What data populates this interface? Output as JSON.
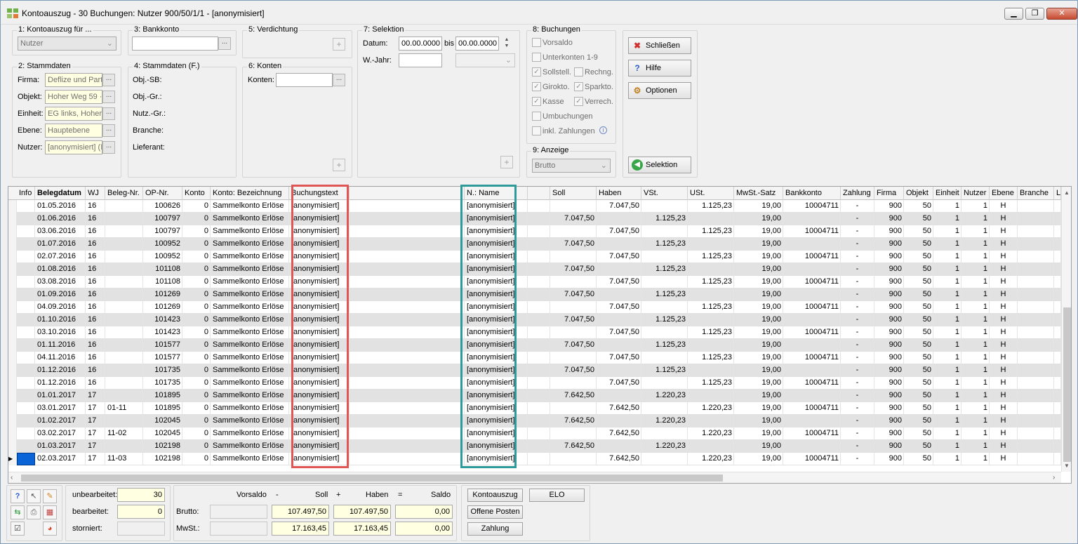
{
  "window": {
    "title": "Kontoauszug - 30 Buchungen:  Nutzer 900/50/1/1 - [anonymisiert]",
    "minimize": "▁",
    "restore": "❐",
    "close": "✕"
  },
  "g1": {
    "title": "1: Kontoauszug für ...",
    "value": "Nutzer"
  },
  "g2": {
    "title": "2: Stammdaten",
    "firma_label": "Firma:",
    "firma": "Deflize und Part",
    "objekt_label": "Objekt:",
    "objekt": "Hoher Weg 59 ·",
    "einheit_label": "Einheit:",
    "einheit": "EG links, Hoher",
    "ebene_label": "Ebene:",
    "ebene": "Hauptebene",
    "nutzer_label": "Nutzer:",
    "nutzer": "[anonymisiert]  (I"
  },
  "g3": {
    "title": "3: Bankkonto",
    "value": ""
  },
  "g4": {
    "title": "4: Stammdaten (F.)",
    "l1": "Obj.-SB:",
    "l2": "Obj.-Gr.:",
    "l3": "Nutz.-Gr.:",
    "l4": "Branche:",
    "l5": "Lieferant:"
  },
  "g5": {
    "title": "5: Verdichtung"
  },
  "g6": {
    "title": "6: Konten",
    "label": "Konten:",
    "value": ""
  },
  "g7": {
    "title": "7: Selektion",
    "datum_label": "Datum:",
    "from": "00.00.0000",
    "bis": "bis",
    "to": "00.00.0000",
    "wjahr_label": "W.-Jahr:",
    "wjahr": ""
  },
  "g8": {
    "title": "8: Buchungen",
    "vorsaldo": "Vorsaldo",
    "unterkonten": "Unterkonten 1-9",
    "sollstell": "Sollstell.",
    "rechng": "Rechng.",
    "girokto": "Girokto.",
    "sparkto": "Sparkto.",
    "kasse": "Kasse",
    "verrech": "Verrech.",
    "umbuchungen": "Umbuchungen",
    "inkl_zahlungen": "inkl. Zahlungen"
  },
  "g9": {
    "title": "9: Anzeige",
    "value": "Brutto"
  },
  "buttons": {
    "schliessen": "Schließen",
    "hilfe": "Hilfe",
    "optionen": "Optionen",
    "selektion": "Selektion"
  },
  "grid": {
    "headers": [
      "Info",
      "Belegdatum",
      "WJ",
      "Beleg-Nr.",
      "OP-Nr.",
      "Konto",
      "Konto: Bezeichnung",
      "Buchungstext",
      "",
      "N.: Name",
      "",
      "Soll",
      "Haben",
      "VSt.",
      "USt.",
      "MwSt.-Satz",
      "Bankkonto",
      "Zahlung",
      "Firma",
      "Objekt",
      "Einheit",
      "Nutzer",
      "Ebene",
      "Branche",
      "L"
    ],
    "rows": [
      [
        "",
        "01.05.2016",
        "16",
        "",
        "100626",
        "0",
        "Sammelkonto Erlöse",
        "[anonymisiert]",
        "",
        "[anonymisiert]",
        "",
        "",
        "7.047,50",
        "",
        "1.125,23",
        "19,00",
        "10004711",
        "-",
        "900",
        "50",
        "1",
        "1",
        "H",
        "",
        ""
      ],
      [
        "",
        "01.06.2016",
        "16",
        "",
        "100797",
        "0",
        "Sammelkonto Erlöse",
        "[anonymisiert]",
        "",
        "[anonymisiert]",
        "",
        "7.047,50",
        "",
        "1.125,23",
        "",
        "19,00",
        "",
        "-",
        "900",
        "50",
        "1",
        "1",
        "H",
        "",
        ""
      ],
      [
        "",
        "03.06.2016",
        "16",
        "",
        "100797",
        "0",
        "Sammelkonto Erlöse",
        "[anonymisiert]",
        "",
        "[anonymisiert]",
        "",
        "",
        "7.047,50",
        "",
        "1.125,23",
        "19,00",
        "10004711",
        "-",
        "900",
        "50",
        "1",
        "1",
        "H",
        "",
        ""
      ],
      [
        "",
        "01.07.2016",
        "16",
        "",
        "100952",
        "0",
        "Sammelkonto Erlöse",
        "[anonymisiert]",
        "",
        "[anonymisiert]",
        "",
        "7.047,50",
        "",
        "1.125,23",
        "",
        "19,00",
        "",
        "-",
        "900",
        "50",
        "1",
        "1",
        "H",
        "",
        ""
      ],
      [
        "",
        "02.07.2016",
        "16",
        "",
        "100952",
        "0",
        "Sammelkonto Erlöse",
        "[anonymisiert]",
        "",
        "[anonymisiert]",
        "",
        "",
        "7.047,50",
        "",
        "1.125,23",
        "19,00",
        "10004711",
        "-",
        "900",
        "50",
        "1",
        "1",
        "H",
        "",
        ""
      ],
      [
        "",
        "01.08.2016",
        "16",
        "",
        "101108",
        "0",
        "Sammelkonto Erlöse",
        "[anonymisiert]",
        "",
        "[anonymisiert]",
        "",
        "7.047,50",
        "",
        "1.125,23",
        "",
        "19,00",
        "",
        "-",
        "900",
        "50",
        "1",
        "1",
        "H",
        "",
        ""
      ],
      [
        "",
        "03.08.2016",
        "16",
        "",
        "101108",
        "0",
        "Sammelkonto Erlöse",
        "[anonymisiert]",
        "",
        "[anonymisiert]",
        "",
        "",
        "7.047,50",
        "",
        "1.125,23",
        "19,00",
        "10004711",
        "-",
        "900",
        "50",
        "1",
        "1",
        "H",
        "",
        ""
      ],
      [
        "",
        "01.09.2016",
        "16",
        "",
        "101269",
        "0",
        "Sammelkonto Erlöse",
        "[anonymisiert]",
        "",
        "[anonymisiert]",
        "",
        "7.047,50",
        "",
        "1.125,23",
        "",
        "19,00",
        "",
        "-",
        "900",
        "50",
        "1",
        "1",
        "H",
        "",
        ""
      ],
      [
        "",
        "04.09.2016",
        "16",
        "",
        "101269",
        "0",
        "Sammelkonto Erlöse",
        "[anonymisiert]",
        "",
        "[anonymisiert]",
        "",
        "",
        "7.047,50",
        "",
        "1.125,23",
        "19,00",
        "10004711",
        "-",
        "900",
        "50",
        "1",
        "1",
        "H",
        "",
        ""
      ],
      [
        "",
        "01.10.2016",
        "16",
        "",
        "101423",
        "0",
        "Sammelkonto Erlöse",
        "[anonymisiert]",
        "",
        "[anonymisiert]",
        "",
        "7.047,50",
        "",
        "1.125,23",
        "",
        "19,00",
        "",
        "-",
        "900",
        "50",
        "1",
        "1",
        "H",
        "",
        ""
      ],
      [
        "",
        "03.10.2016",
        "16",
        "",
        "101423",
        "0",
        "Sammelkonto Erlöse",
        "[anonymisiert]",
        "",
        "[anonymisiert]",
        "",
        "",
        "7.047,50",
        "",
        "1.125,23",
        "19,00",
        "10004711",
        "-",
        "900",
        "50",
        "1",
        "1",
        "H",
        "",
        ""
      ],
      [
        "",
        "01.11.2016",
        "16",
        "",
        "101577",
        "0",
        "Sammelkonto Erlöse",
        "[anonymisiert]",
        "",
        "[anonymisiert]",
        "",
        "7.047,50",
        "",
        "1.125,23",
        "",
        "19,00",
        "",
        "-",
        "900",
        "50",
        "1",
        "1",
        "H",
        "",
        ""
      ],
      [
        "",
        "04.11.2016",
        "16",
        "",
        "101577",
        "0",
        "Sammelkonto Erlöse",
        "[anonymisiert]",
        "",
        "[anonymisiert]",
        "",
        "",
        "7.047,50",
        "",
        "1.125,23",
        "19,00",
        "10004711",
        "-",
        "900",
        "50",
        "1",
        "1",
        "H",
        "",
        ""
      ],
      [
        "",
        "01.12.2016",
        "16",
        "",
        "101735",
        "0",
        "Sammelkonto Erlöse",
        "[anonymisiert]",
        "",
        "[anonymisiert]",
        "",
        "7.047,50",
        "",
        "1.125,23",
        "",
        "19,00",
        "",
        "-",
        "900",
        "50",
        "1",
        "1",
        "H",
        "",
        ""
      ],
      [
        "",
        "01.12.2016",
        "16",
        "",
        "101735",
        "0",
        "Sammelkonto Erlöse",
        "[anonymisiert]",
        "",
        "[anonymisiert]",
        "",
        "",
        "7.047,50",
        "",
        "1.125,23",
        "19,00",
        "10004711",
        "-",
        "900",
        "50",
        "1",
        "1",
        "H",
        "",
        ""
      ],
      [
        "",
        "01.01.2017",
        "17",
        "",
        "101895",
        "0",
        "Sammelkonto Erlöse",
        "[anonymisiert]",
        "",
        "[anonymisiert]",
        "",
        "7.642,50",
        "",
        "1.220,23",
        "",
        "19,00",
        "",
        "-",
        "900",
        "50",
        "1",
        "1",
        "H",
        "",
        ""
      ],
      [
        "",
        "03.01.2017",
        "17",
        "01-11",
        "101895",
        "0",
        "Sammelkonto Erlöse",
        "[anonymisiert]",
        "",
        "[anonymisiert]",
        "",
        "",
        "7.642,50",
        "",
        "1.220,23",
        "19,00",
        "10004711",
        "-",
        "900",
        "50",
        "1",
        "1",
        "H",
        "",
        ""
      ],
      [
        "",
        "01.02.2017",
        "17",
        "",
        "102045",
        "0",
        "Sammelkonto Erlöse",
        "[anonymisiert]",
        "",
        "[anonymisiert]",
        "",
        "7.642,50",
        "",
        "1.220,23",
        "",
        "19,00",
        "",
        "-",
        "900",
        "50",
        "1",
        "1",
        "H",
        "",
        ""
      ],
      [
        "",
        "03.02.2017",
        "17",
        "11-02",
        "102045",
        "0",
        "Sammelkonto Erlöse",
        "[anonymisiert]",
        "",
        "[anonymisiert]",
        "",
        "",
        "7.642,50",
        "",
        "1.220,23",
        "19,00",
        "10004711",
        "-",
        "900",
        "50",
        "1",
        "1",
        "H",
        "",
        ""
      ],
      [
        "",
        "01.03.2017",
        "17",
        "",
        "102198",
        "0",
        "Sammelkonto Erlöse",
        "[anonymisiert]",
        "",
        "[anonymisiert]",
        "",
        "7.642,50",
        "",
        "1.220,23",
        "",
        "19,00",
        "",
        "-",
        "900",
        "50",
        "1",
        "1",
        "H",
        "",
        ""
      ],
      [
        "",
        "02.03.2017",
        "17",
        "11-03",
        "102198",
        "0",
        "Sammelkonto Erlöse",
        "[anonymisiert]",
        "",
        "[anonymisiert]",
        "",
        "",
        "7.642,50",
        "",
        "1.220,23",
        "19,00",
        "10004711",
        "-",
        "900",
        "50",
        "1",
        "1",
        "H",
        "",
        ""
      ]
    ]
  },
  "footer": {
    "unbearbeitet_label": "unbearbeitet:",
    "unbearbeitet": "30",
    "bearbeitet_label": "bearbeitet:",
    "bearbeitet": "0",
    "storniert_label": "storniert:",
    "storniert": "",
    "vorsaldo": "Vorsaldo",
    "minus": "-",
    "soll": "Soll",
    "plus": "+",
    "haben": "Haben",
    "eq": "=",
    "saldo": "Saldo",
    "brutto_label": "Brutto:",
    "brutto_vorsaldo": "",
    "brutto_soll": "107.497,50",
    "brutto_haben": "107.497,50",
    "brutto_saldo": "0,00",
    "mwst_label": "MwSt.:",
    "mwst_vorsaldo": "",
    "mwst_soll": "17.163,45",
    "mwst_haben": "17.163,45",
    "mwst_saldo": "0,00",
    "kontoauszug": "Kontoauszug",
    "elo": "ELO",
    "offene_posten": "Offene Posten",
    "zahlung": "Zahlung"
  }
}
